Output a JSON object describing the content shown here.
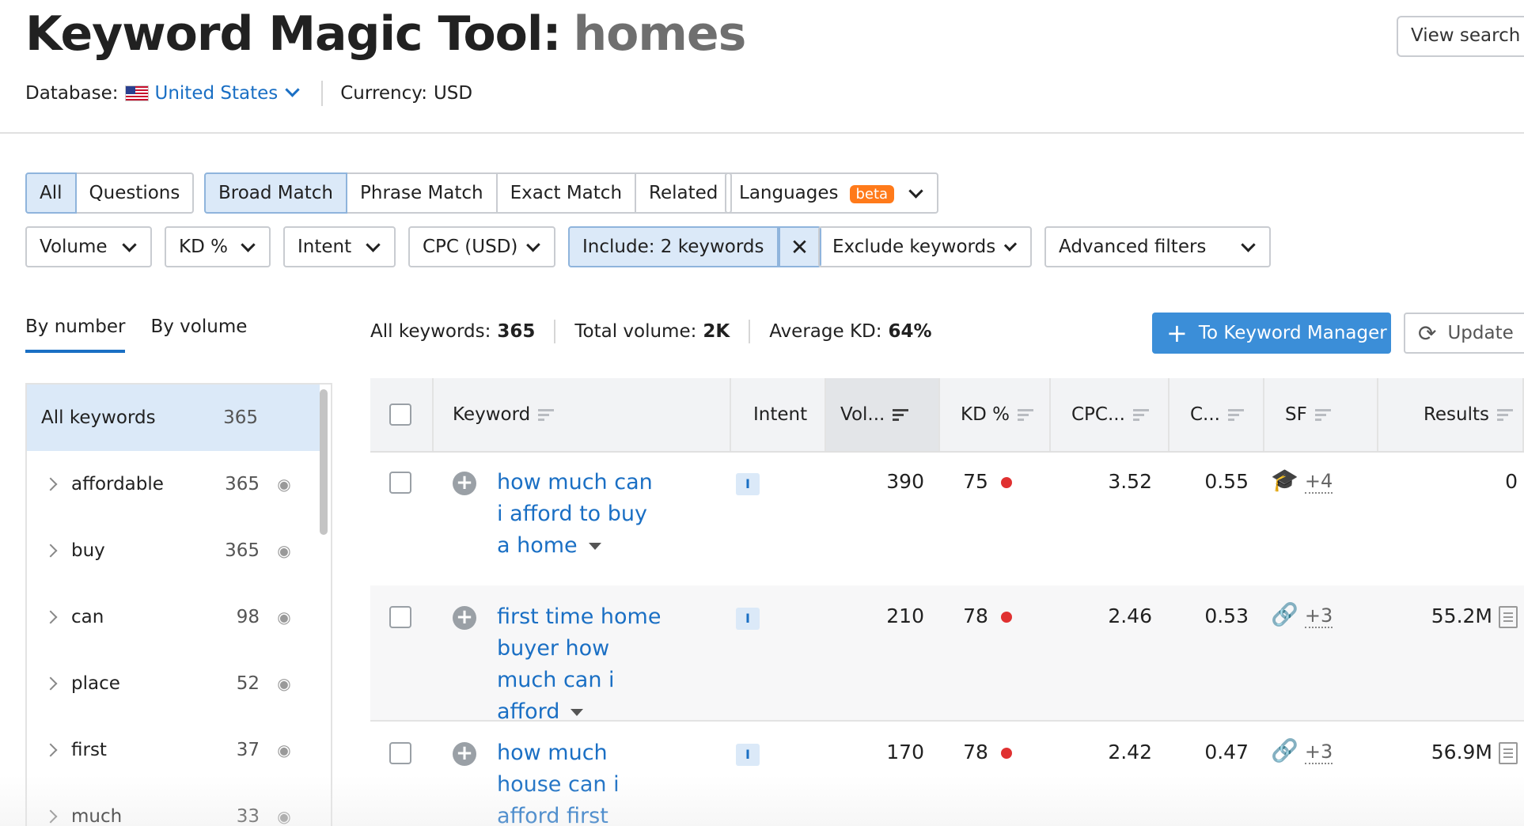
{
  "header": {
    "title": "Keyword Magic Tool:",
    "query": "homes",
    "view_search_label": "View search h",
    "database_label": "Database:",
    "database_value": "United States",
    "currency_label": "Currency:",
    "currency_value": "USD"
  },
  "filters_row1": {
    "scope_tabs": [
      "All",
      "Questions"
    ],
    "match_tabs": [
      "Broad Match",
      "Phrase Match",
      "Exact Match",
      "Related"
    ],
    "languages_label": "Languages",
    "beta_badge": "beta"
  },
  "filters_row2": {
    "volume": "Volume",
    "kd": "KD %",
    "intent": "Intent",
    "cpc": "CPC (USD)",
    "include": "Include: 2 keywords",
    "exclude": "Exclude keywords",
    "advanced": "Advanced filters"
  },
  "group_tabs": [
    "By number",
    "By volume"
  ],
  "stats": {
    "all_keywords_label": "All keywords:",
    "all_keywords_value": "365",
    "total_volume_label": "Total volume:",
    "total_volume_value": "2K",
    "avg_kd_label": "Average KD:",
    "avg_kd_value": "64%"
  },
  "actions": {
    "keyword_manager": "To Keyword Manager",
    "update": "Update"
  },
  "sidebar": {
    "all": {
      "name": "All keywords",
      "count": "365"
    },
    "items": [
      {
        "name": "affordable",
        "count": "365"
      },
      {
        "name": "buy",
        "count": "365"
      },
      {
        "name": "can",
        "count": "98"
      },
      {
        "name": "place",
        "count": "52"
      },
      {
        "name": "first",
        "count": "37"
      },
      {
        "name": "much",
        "count": "33"
      }
    ]
  },
  "table": {
    "columns": {
      "keyword": "Keyword",
      "intent": "Intent",
      "volume": "Vol...",
      "kd": "KD %",
      "cpc": "CPC...",
      "com": "C...",
      "sf": "SF",
      "results": "Results"
    },
    "rows": [
      {
        "keyword": "how much can i afford to buy a home",
        "intent": "I",
        "volume": "390",
        "kd": "75",
        "cpc": "3.52",
        "com": "0.55",
        "sf_extra": "+4",
        "results": "0"
      },
      {
        "keyword": "first time home buyer how much can i afford",
        "intent": "I",
        "volume": "210",
        "kd": "78",
        "cpc": "2.46",
        "com": "0.53",
        "sf_extra": "+3",
        "results": "55.2M"
      },
      {
        "keyword": "how much house can i afford first time home",
        "intent": "I",
        "volume": "170",
        "kd": "78",
        "cpc": "2.42",
        "com": "0.47",
        "sf_extra": "+3",
        "results": "56.9M"
      }
    ]
  },
  "colors": {
    "accent": "#1a6fc4",
    "primary_button": "#3b8ed8",
    "kd_dot": "#e03131",
    "beta": "#ff7a1a"
  }
}
